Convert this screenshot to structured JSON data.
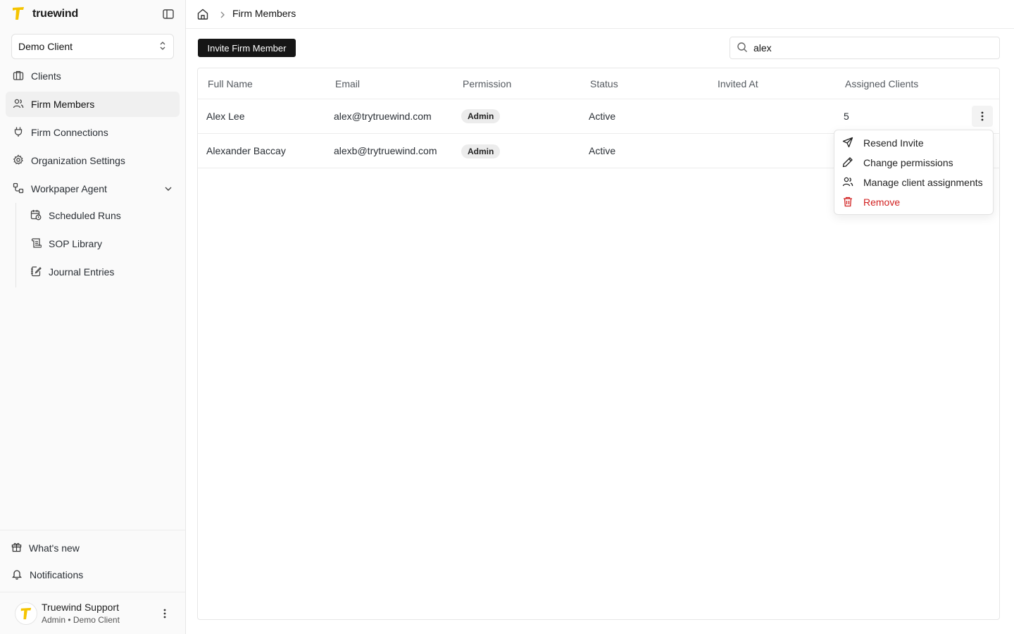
{
  "app": {
    "brand_name": "truewind",
    "brand_color": "#f5c400"
  },
  "sidebar": {
    "client_selector": "Demo Client",
    "items": [
      {
        "label": "Clients",
        "icon": "briefcase-icon"
      },
      {
        "label": "Firm Members",
        "icon": "users-icon",
        "active": true
      },
      {
        "label": "Firm Connections",
        "icon": "plug-icon"
      },
      {
        "label": "Organization Settings",
        "icon": "gear-icon"
      },
      {
        "label": "Workpaper Agent",
        "icon": "workflow-icon",
        "expanded": true
      }
    ],
    "sub_items": [
      {
        "label": "Scheduled Runs",
        "icon": "calendar-clock-icon"
      },
      {
        "label": "SOP Library",
        "icon": "scroll-icon"
      },
      {
        "label": "Journal Entries",
        "icon": "notebook-pen-icon"
      }
    ],
    "bottom": {
      "whats_new": "What's new",
      "notifications": "Notifications"
    },
    "user": {
      "name": "Truewind Support",
      "subtitle": "Admin • Demo Client"
    }
  },
  "breadcrumb": {
    "current": "Firm Members"
  },
  "toolbar": {
    "invite_label": "Invite Firm Member",
    "search_value": "alex",
    "search_placeholder": "Search"
  },
  "table": {
    "headers": [
      "Full Name",
      "Email",
      "Permission",
      "Status",
      "Invited At",
      "Assigned Clients"
    ],
    "rows": [
      {
        "name": "Alex Lee",
        "email": "alex@trytruewind.com",
        "permission": "Admin",
        "status": "Active",
        "invited_at": "",
        "assigned": "5"
      },
      {
        "name": "Alexander Baccay",
        "email": "alexb@trytruewind.com",
        "permission": "Admin",
        "status": "Active",
        "invited_at": "",
        "assigned": ""
      }
    ]
  },
  "row_menu": {
    "items": [
      {
        "label": "Resend Invite",
        "icon": "send-icon"
      },
      {
        "label": "Change permissions",
        "icon": "pencil-icon"
      },
      {
        "label": "Manage client assignments",
        "icon": "users-icon"
      },
      {
        "label": "Remove",
        "icon": "trash-icon",
        "danger": true
      }
    ],
    "danger_color": "#d11f1f"
  }
}
